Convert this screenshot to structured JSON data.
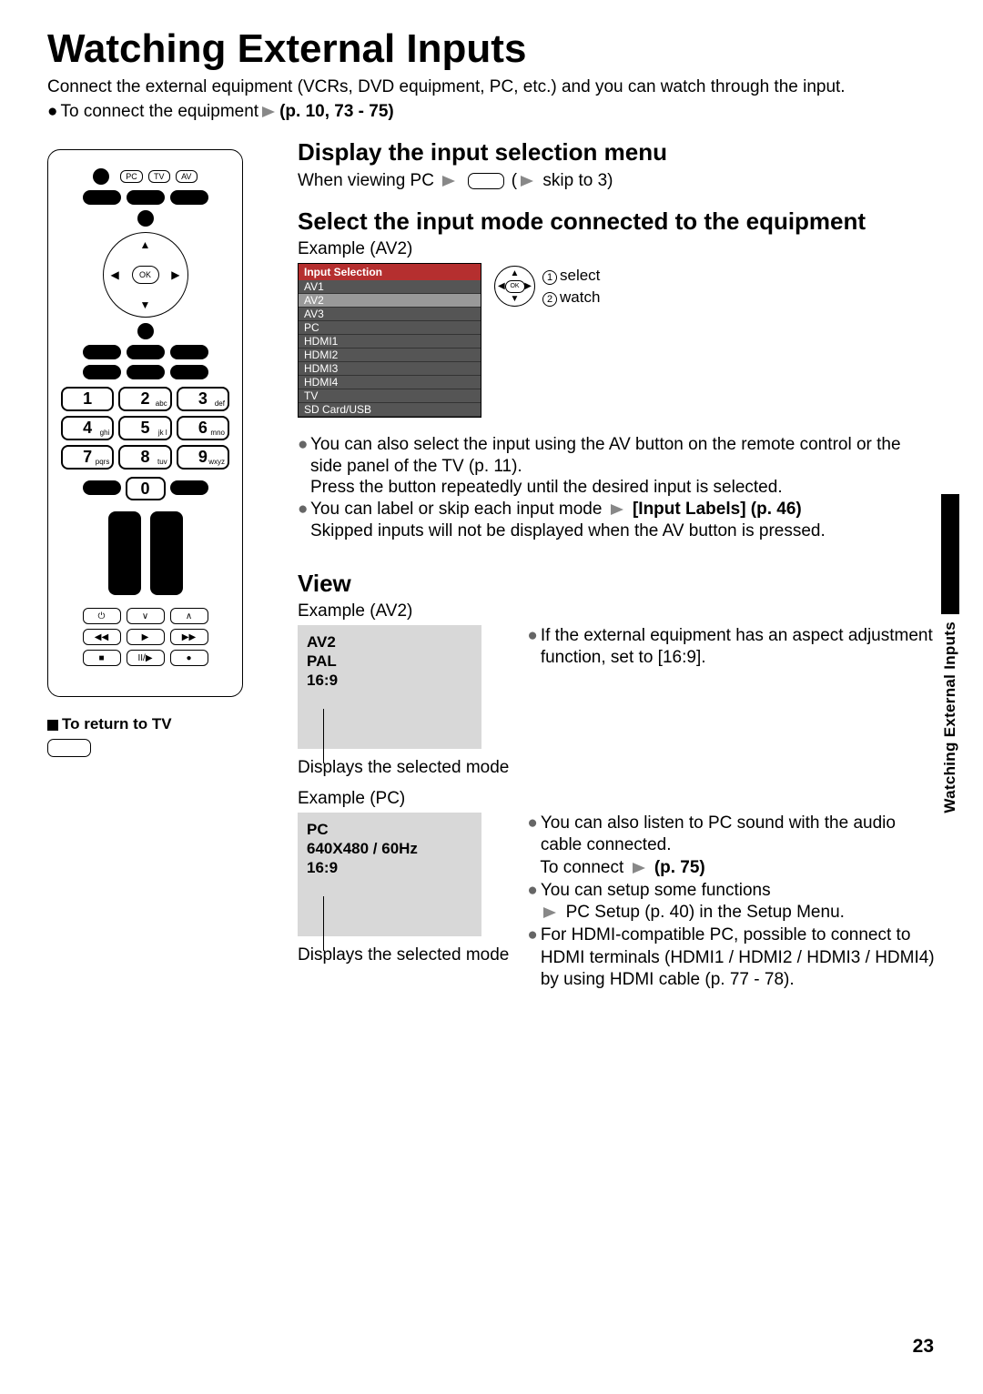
{
  "page": {
    "title": "Watching External Inputs",
    "intro": "Connect the external equipment (VCRs, DVD equipment, PC, etc.) and you can watch through the input.",
    "connect_prefix": "To connect the equipment",
    "connect_ref": "(p. 10, 73 - 75)",
    "side_tab": "Watching External Inputs",
    "number": "23"
  },
  "remote": {
    "keys_top": [
      "PC",
      "TV",
      "AV"
    ],
    "ok": "OK",
    "keypad": [
      {
        "n": "1",
        "sub": ""
      },
      {
        "n": "2",
        "sub": "abc"
      },
      {
        "n": "3",
        "sub": "def"
      },
      {
        "n": "4",
        "sub": "ghi"
      },
      {
        "n": "5",
        "sub": "jk l"
      },
      {
        "n": "6",
        "sub": "mno"
      },
      {
        "n": "7",
        "sub": "pqrs"
      },
      {
        "n": "8",
        "sub": "tuv"
      },
      {
        "n": "9",
        "sub": "wxyz"
      }
    ],
    "zero": "0",
    "media_row1": [
      "⏻",
      "∨",
      "∧"
    ],
    "media_row2": [
      "◀◀",
      "▶",
      "▶▶"
    ],
    "media_row3": [
      "■",
      "II/▶",
      "●"
    ],
    "return_label": "To return to TV"
  },
  "section1": {
    "heading": "Display the input selection menu",
    "line_prefix": "When viewing PC",
    "line_suffix": "skip to 3)"
  },
  "section2": {
    "heading": "Select the input mode connected to the equipment",
    "example_label": "Example (AV2)",
    "menu_title": "Input Selection",
    "menu_items": [
      "AV1",
      "AV2",
      "AV3",
      "PC",
      "HDMI1",
      "HDMI2",
      "HDMI3",
      "HDMI4",
      "TV",
      "SD Card/USB"
    ],
    "ok": "OK",
    "label_select": "select",
    "label_watch": "watch",
    "notes": {
      "n1": "You can also select the input using the AV button on the remote control or the side panel of the TV (p. 11).",
      "n1b": "Press the button repeatedly until the desired input is selected.",
      "n2a": "You can label or skip each input mode",
      "n2b": "[Input Labels] (p. 46)",
      "n2c": "Skipped inputs will not be displayed when the AV button is pressed."
    }
  },
  "section3": {
    "heading": "View",
    "exampleA_label": "Example (AV2)",
    "previewA_lines": [
      "AV2",
      "PAL",
      "16:9"
    ],
    "previewA_caption": "Displays the selected mode",
    "noteA": "If the external equipment has an aspect adjustment function, set to [16:9].",
    "exampleB_label": "Example (PC)",
    "previewB_lines": [
      "PC",
      "640X480 / 60Hz",
      "16:9"
    ],
    "previewB_caption": "Displays the selected mode",
    "notesB": {
      "n1": "You can also listen to PC sound with the audio cable connected.",
      "n1b_prefix": "To connect",
      "n1b_ref": "(p. 75)",
      "n2": "You can setup some functions",
      "n2b": "PC Setup (p. 40) in the Setup Menu.",
      "n3": "For HDMI-compatible PC, possible to connect to HDMI terminals (HDMI1 / HDMI2 / HDMI3 / HDMI4) by using HDMI cable (p. 77 - 78)."
    }
  }
}
